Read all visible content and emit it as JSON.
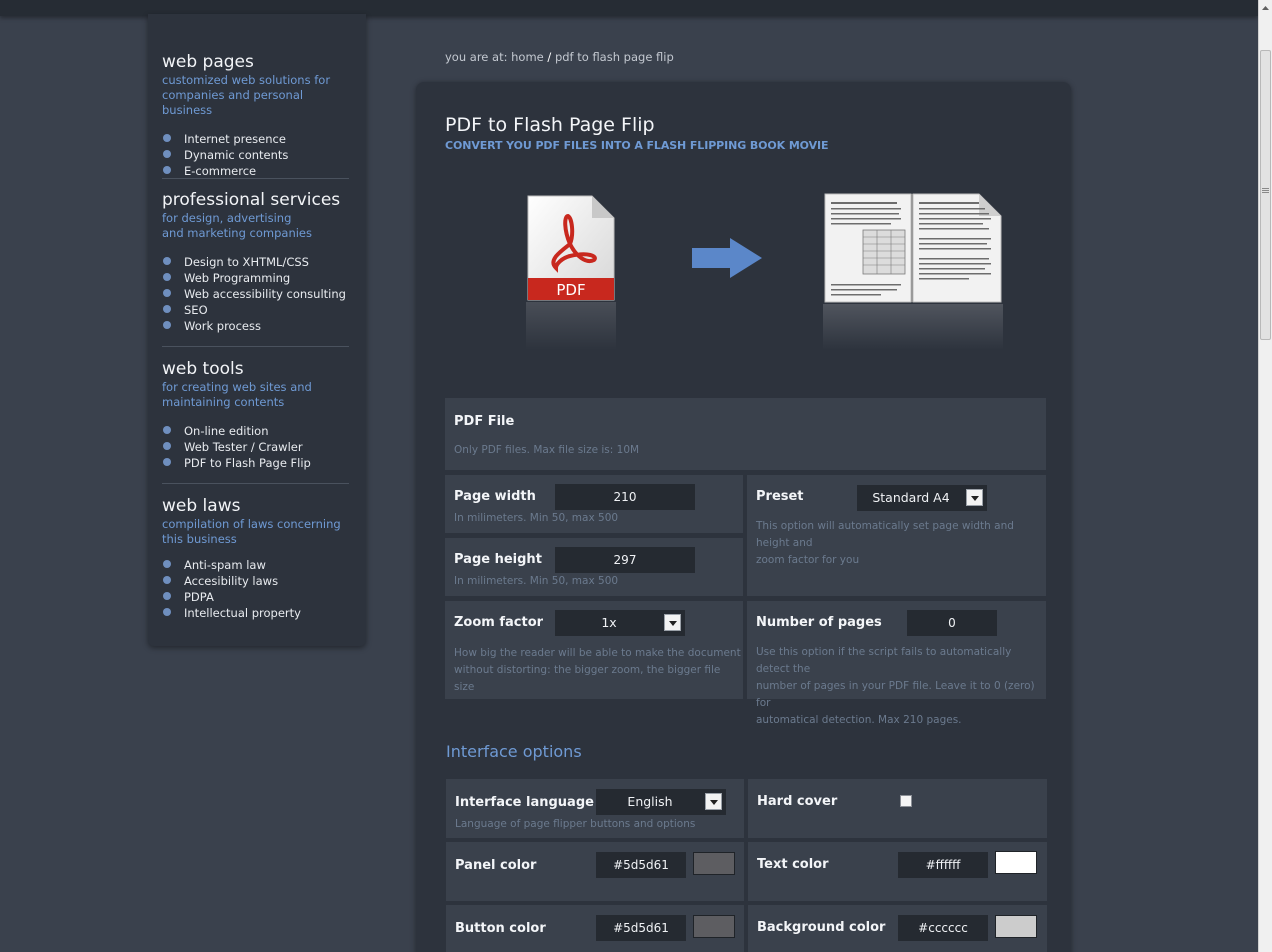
{
  "sidebar": {
    "sections": [
      {
        "title": "web pages",
        "subtitle": [
          "customized web solutions for",
          "companies and personal business"
        ],
        "items": [
          "Internet presence",
          "Dynamic contents",
          "E-commerce"
        ]
      },
      {
        "title": "professional services",
        "subtitle": [
          "for design, advertising",
          "and marketing companies"
        ],
        "items": [
          "Design to XHTML/CSS",
          "Web Programming",
          "Web accessibility consulting",
          "SEO",
          "Work process"
        ]
      },
      {
        "title": "web tools",
        "subtitle": [
          "for creating web sites and",
          "maintaining contents"
        ],
        "items": [
          "On-line edition",
          "Web Tester / Crawler",
          "PDF to Flash Page Flip"
        ]
      },
      {
        "title": "web laws",
        "subtitle": [
          "compilation of laws concerning",
          "this business"
        ],
        "items": [
          "Anti-spam law",
          "Accesibility laws",
          "PDPA",
          "Intellectual property"
        ]
      }
    ]
  },
  "breadcrumb": {
    "prefix": "you are at:",
    "home": "home",
    "separator": "/",
    "current": "pdf to flash page flip"
  },
  "page": {
    "title": "PDF to Flash Page Flip",
    "subtitle": "CONVERT YOU PDF FILES INTO A FLASH FLIPPING BOOK MOVIE",
    "pdf_badge": "PDF"
  },
  "form": {
    "pdf_file": {
      "label": "PDF File",
      "hint": "Only PDF files. Max file size is: 10M"
    },
    "page_width": {
      "label": "Page width",
      "value": "210",
      "hint": "In milimeters. Min 50, max 500"
    },
    "page_height": {
      "label": "Page height",
      "value": "297",
      "hint": "In milimeters. Min 50, max 500"
    },
    "preset": {
      "label": "Preset",
      "value": "Standard A4",
      "hint_lines": [
        "This option will automatically set page width and height and",
        "zoom factor for you"
      ]
    },
    "zoom": {
      "label": "Zoom factor",
      "value": "1x",
      "hint_lines": [
        "How big the reader will be able to make the document",
        "without distorting: the bigger zoom, the bigger file size"
      ]
    },
    "num_pages": {
      "label": "Number of pages",
      "value": "0",
      "hint_lines": [
        "Use this option if the script fails to automatically detect the",
        "number of pages in your PDF file. Leave it to 0 (zero) for",
        "automatical detection. Max 210 pages."
      ]
    }
  },
  "interface": {
    "title": "Interface options",
    "language": {
      "label": "Interface language",
      "value": "English",
      "hint": "Language of page flipper buttons and options"
    },
    "hard_cover": {
      "label": "Hard cover",
      "checked": false
    },
    "panel_color": {
      "label": "Panel color",
      "value": "#5d5d61",
      "swatch": "#5d5d61"
    },
    "text_color": {
      "label": "Text color",
      "value": "#ffffff",
      "swatch": "#ffffff"
    },
    "button_color": {
      "label": "Button color",
      "value": "#5d5d61",
      "swatch": "#5d5d61"
    },
    "background_color": {
      "label": "Background color",
      "value": "#cccccc",
      "swatch": "#cccccc"
    }
  }
}
